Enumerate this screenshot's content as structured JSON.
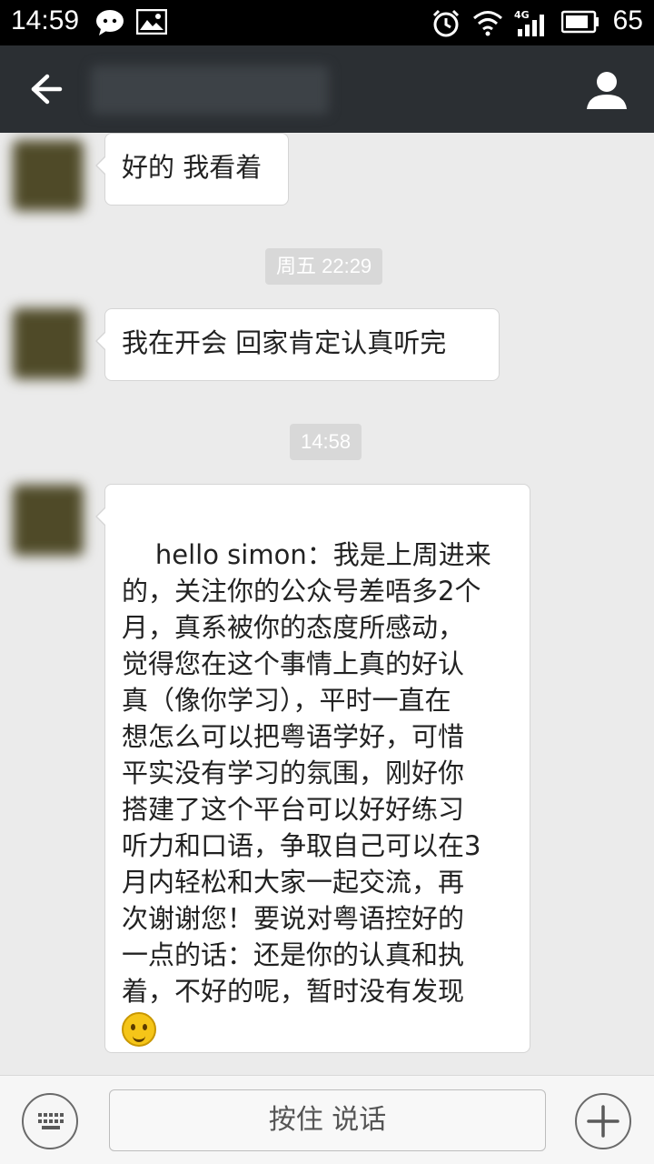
{
  "status_bar": {
    "time": "14:59",
    "network": "4G",
    "battery": "65"
  },
  "header": {
    "back_icon": "back-arrow-icon",
    "profile_icon": "person-icon"
  },
  "messages": [
    {
      "type": "received",
      "text": "好的 我看着"
    },
    {
      "type": "timestamp",
      "text": "周五 22:29"
    },
    {
      "type": "received",
      "text": "我在开会 回家肯定认真听完"
    },
    {
      "type": "timestamp",
      "text": "14:58"
    },
    {
      "type": "received",
      "text": "hello simon：我是上周进来\n的，关注你的公众号差唔多2个\n月，真系被你的态度所感动，\n觉得您在这个事情上真的好认\n真（像你学习），平时一直在\n想怎么可以把粤语学好，可惜\n平实没有学习的氛围，刚好你\n搭建了这个平台可以好好练习\n听力和口语，争取自己可以在3\n月内轻松和大家一起交流，再\n次谢谢您！要说对粤语控好的\n一点的话：还是你的认真和执\n着，不好的呢，暂时没有发现",
      "emoji": "thinking-face-emoji"
    }
  ],
  "input_bar": {
    "hold_to_talk": "按住 说话",
    "keyboard_icon": "keyboard-icon",
    "plus_icon": "plus-icon"
  }
}
